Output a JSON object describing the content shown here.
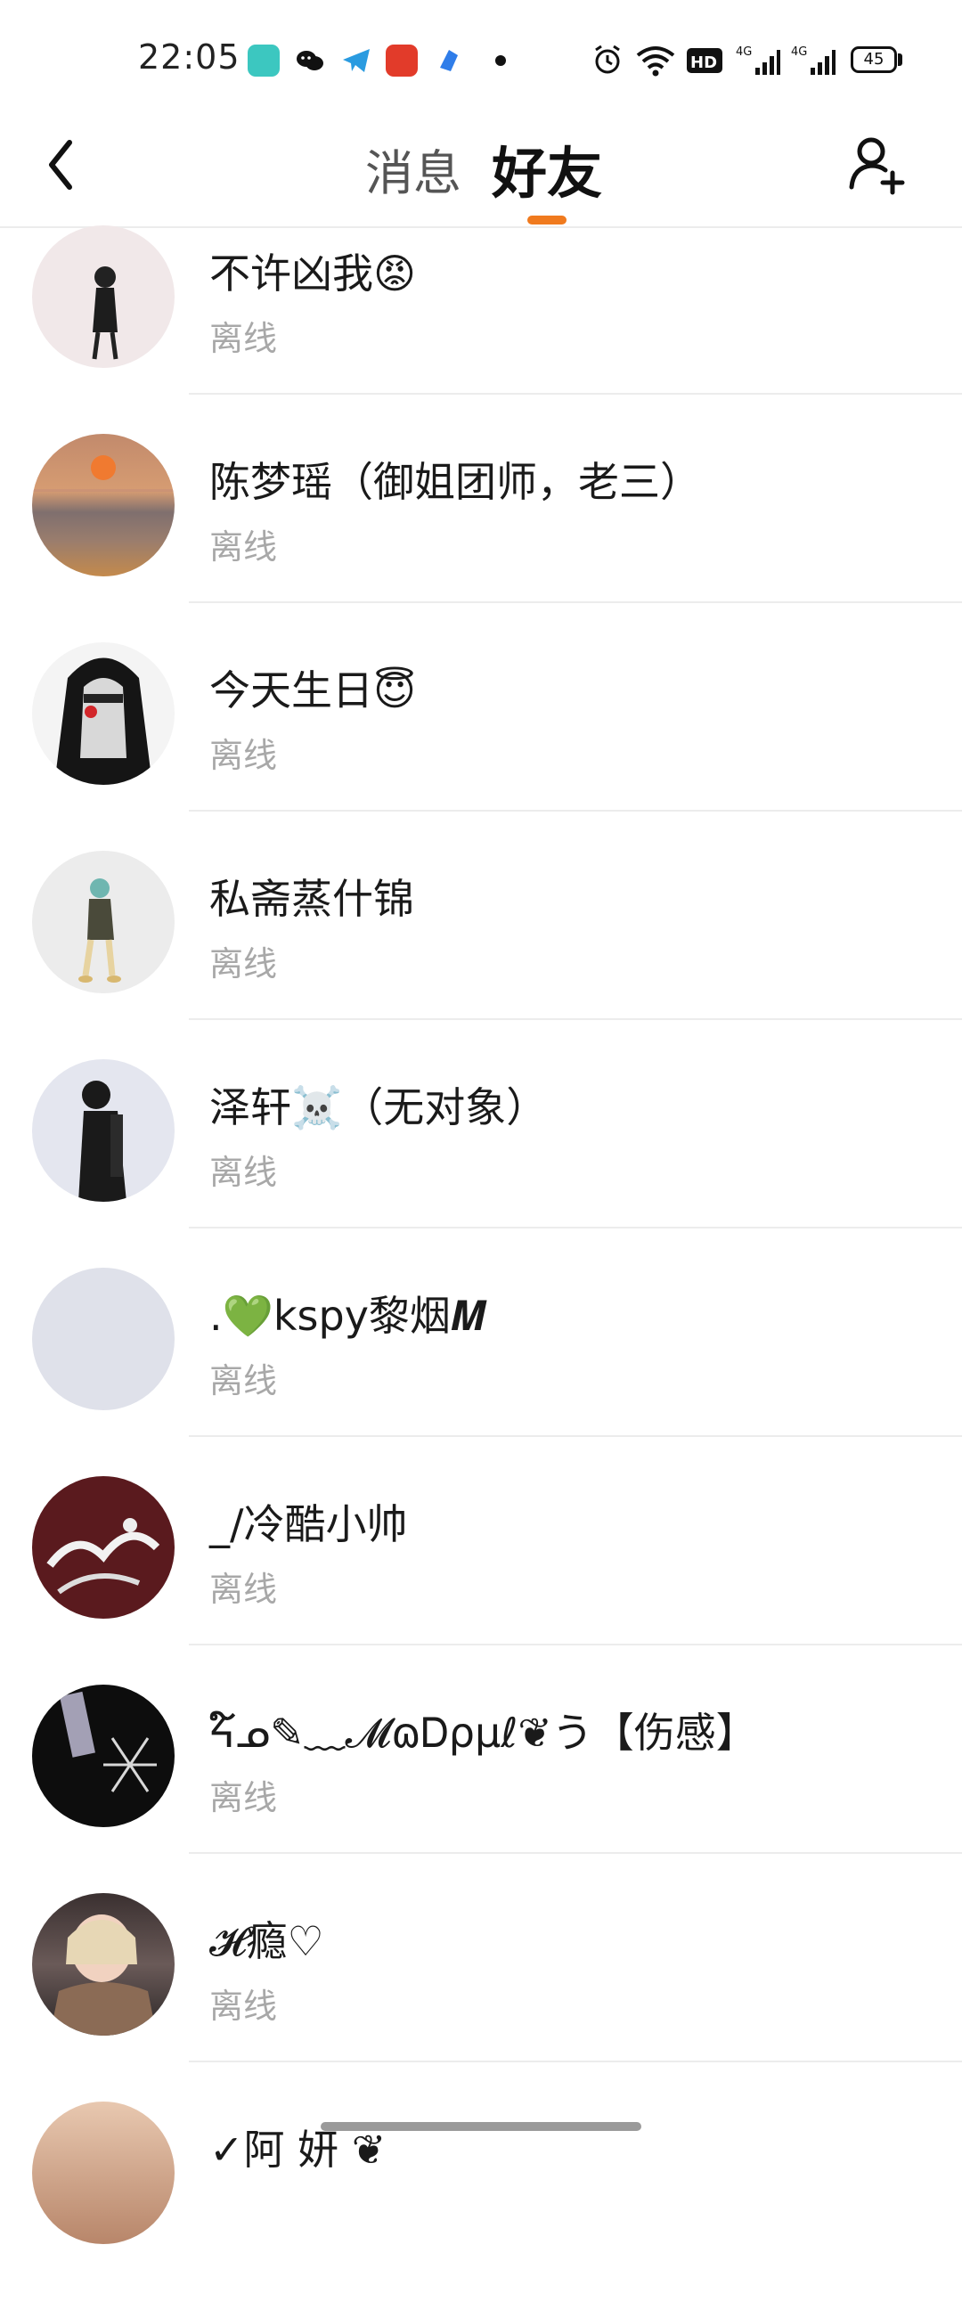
{
  "status_bar": {
    "time": "22:05",
    "battery": "45"
  },
  "header": {
    "tab_messages": "消息",
    "tab_friends": "好友"
  },
  "friends": [
    {
      "name": "不许凶我😡",
      "status": "离线",
      "avatar": "girl-figure"
    },
    {
      "name": "陈梦瑶（御姐团师，老三）",
      "status": "离线",
      "avatar": "sunset-sea"
    },
    {
      "name": "今天生日😇",
      "status": "离线",
      "avatar": "hooded-girl"
    },
    {
      "name": "私斋蒸什锦",
      "status": "离线",
      "avatar": "standing-figure"
    },
    {
      "name": "泽轩☠️（无对象）",
      "status": "离线",
      "avatar": "boy-silhouette"
    },
    {
      "name": ".💚kspy黎烟𝑴",
      "status": "离线",
      "avatar": "blank"
    },
    {
      "name": "_/冷酷小帅",
      "status": "离线",
      "avatar": "graffiti-dark-red"
    },
    {
      "name": "ᔦ໌ᓄ✎﹏𝓜ɷᎠρμℓ❦う【伤感】",
      "status": "离线",
      "avatar": "dark-chain"
    },
    {
      "name": "𝓗瘾♡",
      "status": "离线",
      "avatar": "photo-girl-scarf"
    },
    {
      "name": "✓阿 妍 ❦",
      "status": "离线",
      "avatar": "photo-girl"
    }
  ],
  "colors": {
    "accent": "#f07a1e",
    "muted": "#a8a8a8",
    "divider": "#ececec"
  }
}
